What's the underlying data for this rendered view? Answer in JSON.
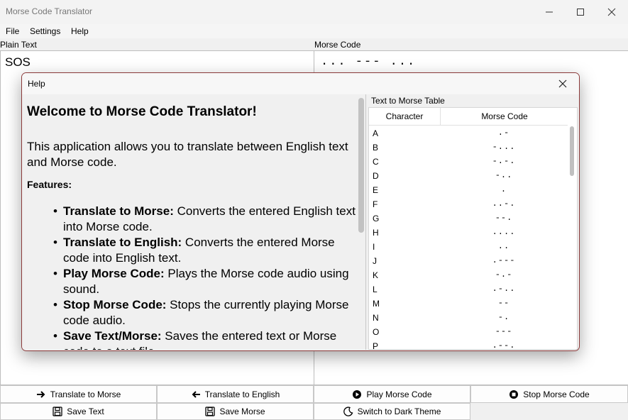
{
  "window": {
    "title": "Morse Code Translator"
  },
  "menu": [
    "File",
    "Settings",
    "Help"
  ],
  "panes": {
    "plain_label": "Plain Text",
    "plain_value": "SOS",
    "morse_label": "Morse Code",
    "morse_value": "... --- ..."
  },
  "buttons": {
    "translate_to_morse": "Translate to Morse",
    "translate_to_english": "Translate to English",
    "play_morse": "Play Morse Code",
    "stop_morse": "Stop Morse Code",
    "save_text": "Save Text",
    "save_morse": "Save Morse",
    "dark_theme": "Switch to Dark Theme"
  },
  "help": {
    "title": "Help",
    "heading": "Welcome to Morse Code Translator!",
    "intro": "This application allows you to translate between English text and Morse code.",
    "features_label": "Features:",
    "features": [
      {
        "name": "Translate to Morse:",
        "desc": " Converts the entered English text into Morse code."
      },
      {
        "name": "Translate to English:",
        "desc": " Converts the entered Morse code into English text."
      },
      {
        "name": "Play Morse Code:",
        "desc": " Plays the Morse code audio using sound."
      },
      {
        "name": "Stop Morse Code:",
        "desc": " Stops the currently playing Morse code audio."
      },
      {
        "name": "Save Text/Morse:",
        "desc": " Saves the entered text or Morse code to a text file."
      }
    ],
    "table_label": "Text to Morse Table",
    "table_headers": [
      "Character",
      "Morse Code"
    ],
    "table_rows": [
      [
        "A",
        ".-"
      ],
      [
        "B",
        "-..."
      ],
      [
        "C",
        "-.-."
      ],
      [
        "D",
        "-.."
      ],
      [
        "E",
        "."
      ],
      [
        "F",
        "..-."
      ],
      [
        "G",
        "--."
      ],
      [
        "H",
        "...."
      ],
      [
        "I",
        ".."
      ],
      [
        "J",
        ".---"
      ],
      [
        "K",
        "-.-"
      ],
      [
        "L",
        ".-.."
      ],
      [
        "M",
        "--"
      ],
      [
        "N",
        "-."
      ],
      [
        "O",
        "---"
      ],
      [
        "P",
        ".--."
      ]
    ]
  }
}
